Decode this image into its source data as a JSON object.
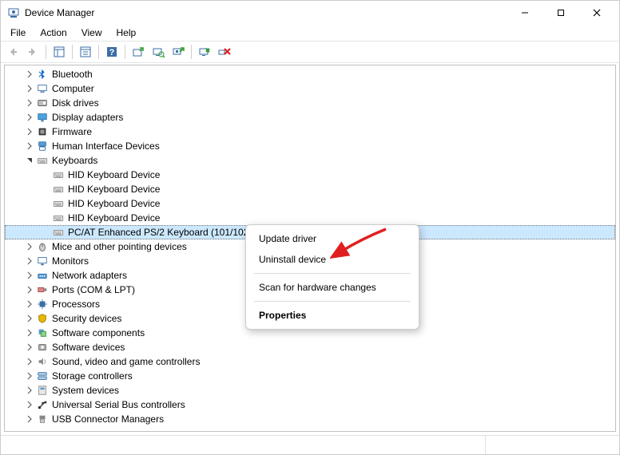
{
  "title": "Device Manager",
  "menu": {
    "file": "File",
    "action": "Action",
    "view": "View",
    "help": "Help"
  },
  "context_menu": {
    "update": "Update driver",
    "uninstall": "Uninstall device",
    "scan": "Scan for hardware changes",
    "properties": "Properties"
  },
  "tree": [
    {
      "label": "Bluetooth",
      "icon": "bluetooth",
      "indent": 1,
      "expanded": false
    },
    {
      "label": "Computer",
      "icon": "computer",
      "indent": 1,
      "expanded": false
    },
    {
      "label": "Disk drives",
      "icon": "disk",
      "indent": 1,
      "expanded": false
    },
    {
      "label": "Display adapters",
      "icon": "display",
      "indent": 1,
      "expanded": false
    },
    {
      "label": "Firmware",
      "icon": "firmware",
      "indent": 1,
      "expanded": false
    },
    {
      "label": "Human Interface Devices",
      "icon": "hid",
      "indent": 1,
      "expanded": false
    },
    {
      "label": "Keyboards",
      "icon": "keyboard",
      "indent": 1,
      "expanded": true
    },
    {
      "label": "HID Keyboard Device",
      "icon": "keyboard",
      "indent": 2,
      "leaf": true
    },
    {
      "label": "HID Keyboard Device",
      "icon": "keyboard",
      "indent": 2,
      "leaf": true
    },
    {
      "label": "HID Keyboard Device",
      "icon": "keyboard",
      "indent": 2,
      "leaf": true
    },
    {
      "label": "HID Keyboard Device",
      "icon": "keyboard",
      "indent": 2,
      "leaf": true
    },
    {
      "label": "PC/AT Enhanced PS/2 Keyboard (101/102-Key)",
      "icon": "keyboard",
      "indent": 2,
      "leaf": true,
      "selected": true
    },
    {
      "label": "Mice and other pointing devices",
      "icon": "mouse",
      "indent": 1,
      "expanded": false
    },
    {
      "label": "Monitors",
      "icon": "monitor",
      "indent": 1,
      "expanded": false
    },
    {
      "label": "Network adapters",
      "icon": "network",
      "indent": 1,
      "expanded": false
    },
    {
      "label": "Ports (COM & LPT)",
      "icon": "port",
      "indent": 1,
      "expanded": false
    },
    {
      "label": "Processors",
      "icon": "cpu",
      "indent": 1,
      "expanded": false
    },
    {
      "label": "Security devices",
      "icon": "security",
      "indent": 1,
      "expanded": false
    },
    {
      "label": "Software components",
      "icon": "swcomp",
      "indent": 1,
      "expanded": false
    },
    {
      "label": "Software devices",
      "icon": "swdev",
      "indent": 1,
      "expanded": false
    },
    {
      "label": "Sound, video and game controllers",
      "icon": "sound",
      "indent": 1,
      "expanded": false
    },
    {
      "label": "Storage controllers",
      "icon": "storage",
      "indent": 1,
      "expanded": false
    },
    {
      "label": "System devices",
      "icon": "system",
      "indent": 1,
      "expanded": false
    },
    {
      "label": "Universal Serial Bus controllers",
      "icon": "usb",
      "indent": 1,
      "expanded": false
    },
    {
      "label": "USB Connector Managers",
      "icon": "usbconn",
      "indent": 1,
      "expanded": false
    }
  ]
}
